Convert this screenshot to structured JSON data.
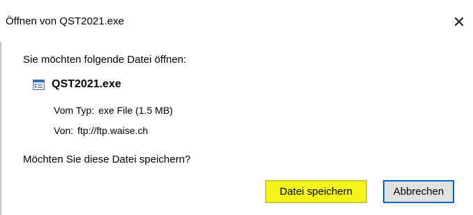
{
  "window": {
    "title": "Öffnen von QST2021.exe",
    "close_glyph": "✕"
  },
  "dialog": {
    "prompt": "Sie möchten folgende Datei öffnen:",
    "file_name": "QST2021.exe",
    "file_icon": "exe-file-icon",
    "type_label": "Vom Typ:",
    "type_value": "exe File (1.5 MB)",
    "from_label": "Von:",
    "from_value": "ftp://ftp.waise.ch",
    "question": "Möchten Sie diese Datei speichern?"
  },
  "buttons": {
    "save_label": "Datei speichern",
    "cancel_label": "Abbrechen"
  },
  "colors": {
    "save_highlight": "#f4f51a",
    "focus_border": "#0a64c8",
    "button_face": "#e1e1e1"
  }
}
